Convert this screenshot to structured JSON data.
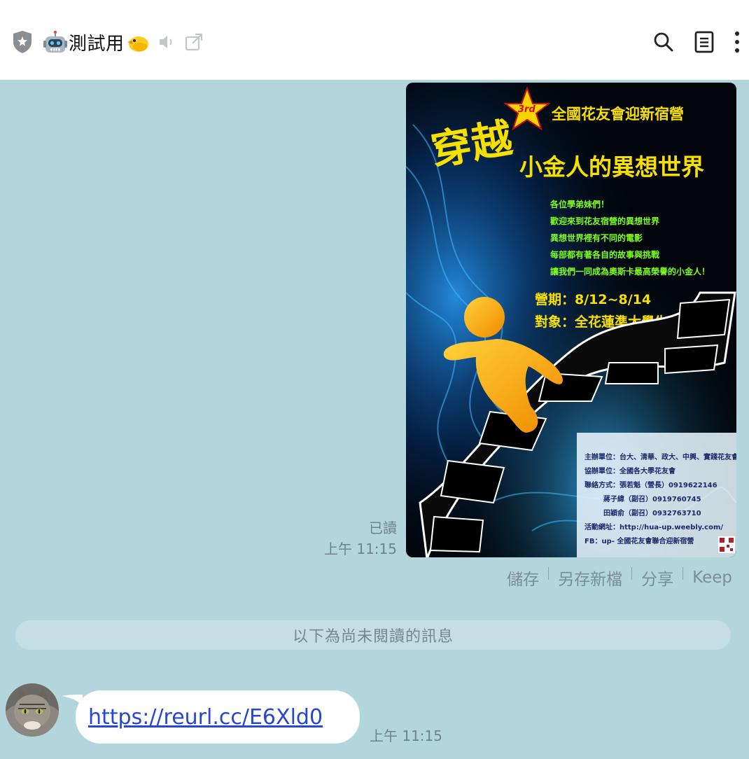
{
  "header": {
    "chat_name": "測試用",
    "icons": [
      "shield-icon",
      "robot-emoji-icon",
      "duck-emoji-icon",
      "speaker-muted-icon",
      "external-link-icon",
      "search-icon",
      "notes-icon",
      "more-vertical-icon"
    ]
  },
  "poster": {
    "edition": "3rd",
    "subtitle": "全國花友會迎新宿營",
    "title_main": "穿越",
    "title_sub": "小金人的異想世界",
    "intro_lines": [
      "各位學弟妹們！",
      "歡迎來到花友宿營的異想世界",
      "異想世界裡有不同的電影",
      "每部都有著各自的故事與挑戰",
      "讓我們一同成為奧斯卡最高榮譽的小金人！"
    ],
    "date_line": "營期：8/12~8/14",
    "target_line": "對象：全花蓮準大學生",
    "info_lines": [
      "主辦單位：台大、清華、政大、中興、實踐花友會",
      "協辦單位：全國各大學花友會",
      "聯絡方式：張若魁（營長）0919622146",
      "蔣子緯（副召）0919760745",
      "田穎俞（副召）0932763710",
      "活動網址：http://hua-up.weebly.com/",
      "FB：up- 全國花友會聯合迎新宿營"
    ]
  },
  "message_out": {
    "read_label": "已讀",
    "time": "上午 11:15"
  },
  "image_actions": {
    "save": "儲存",
    "save_as": "另存新檔",
    "share": "分享",
    "keep": "Keep"
  },
  "unread_divider": "以下為尚未閱讀的訊息",
  "message_in": {
    "link": "https://reurl.cc/E6Xld0",
    "time": "上午 11:15"
  },
  "colors": {
    "background": "#b2d6dc",
    "header": "#ffffff",
    "link": "#2546d6",
    "poster_yellow": "#f7e000",
    "poster_green": "#7fff1a"
  }
}
